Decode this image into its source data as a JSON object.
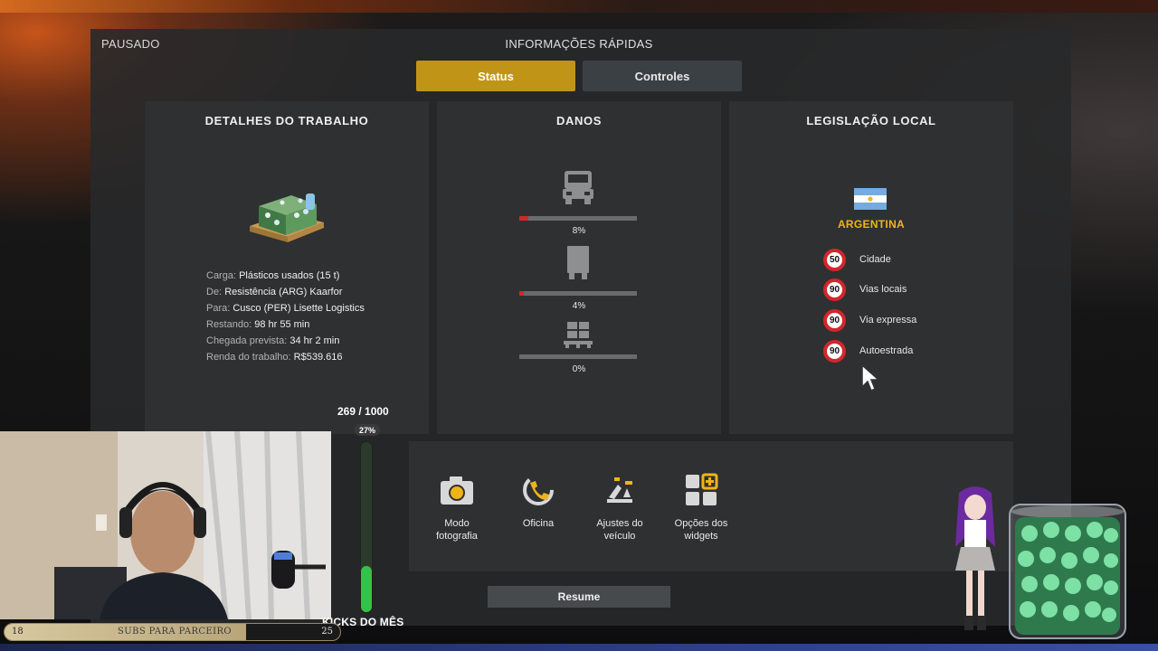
{
  "header": {
    "paused": "PAUSADO",
    "title": "INFORMAÇÕES RÁPIDAS"
  },
  "tabs": [
    {
      "label": "Status",
      "active": true
    },
    {
      "label": "Controles",
      "active": false
    }
  ],
  "job": {
    "title": "DETALHES DO TRABALHO",
    "cargo_label": "Carga:",
    "cargo_value": "Plásticos usados (15 t)",
    "from_label": "De:",
    "from_value": "Resistência (ARG) Kaarfor",
    "to_label": "Para:",
    "to_value": "Cusco (PER) Lisette Logistics",
    "remaining_label": "Restando:",
    "remaining_value": "98 hr 55 min",
    "eta_label": "Chegada prevista:",
    "eta_value": "34 hr 2 min",
    "income_label": "Renda do trabalho:",
    "income_value": "R$539.616"
  },
  "damage": {
    "title": "DANOS",
    "truck": {
      "icon": "truck-icon",
      "pct": "8%",
      "level": 8
    },
    "trailer": {
      "icon": "trailer-icon",
      "pct": "4%",
      "level": 4
    },
    "cargo": {
      "icon": "cargo-boxes-icon",
      "pct": "0%",
      "level": 0
    }
  },
  "legislation": {
    "title": "LEGISLAÇÃO LOCAL",
    "country": "ARGENTINA",
    "limits": [
      {
        "speed": "50",
        "label": "Cidade"
      },
      {
        "speed": "90",
        "label": "Vias locais"
      },
      {
        "speed": "90",
        "label": "Via expressa"
      },
      {
        "speed": "90",
        "label": "Autoestrada"
      }
    ]
  },
  "actions": {
    "photo": "Modo\nfotografia",
    "workshop": "Oficina",
    "vehicle": "Ajustes do\nveículo",
    "widgets": "Opções dos\nwidgets",
    "resume": "Resume"
  },
  "overlay": {
    "kicks_count": "269 / 1000",
    "kicks_pct": "27%",
    "kicks_level": 27,
    "kicks_label": "KICKS DO MÊS",
    "subs_start": "18",
    "subs_text": "SUBS PARA PARCEIRO",
    "subs_end": "25",
    "subs_level": 72
  },
  "colors": {
    "accent": "#c09416",
    "damage": "#cc2a2a",
    "country": "#f1b418",
    "kicks": "#35c24a"
  }
}
